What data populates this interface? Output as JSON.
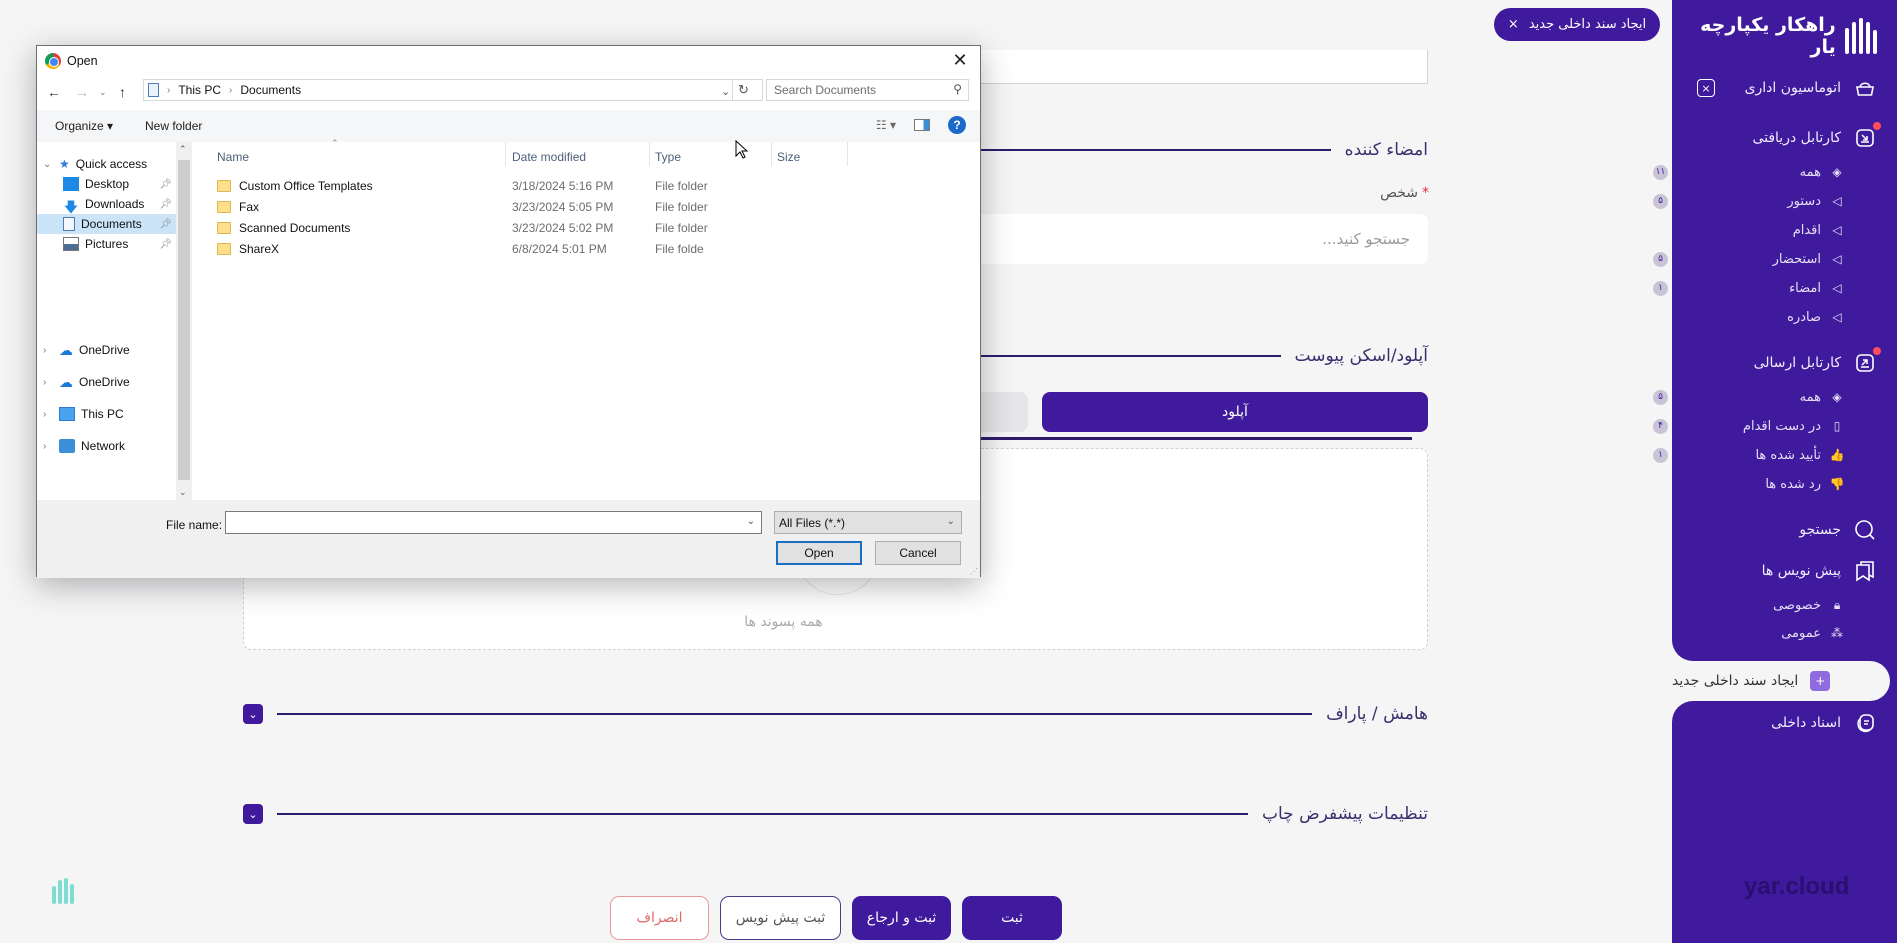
{
  "app": {
    "brand": "راهکار یکپارچه یار",
    "footer_brand": "yar.cloud",
    "accent_color": "#3f1a9c"
  },
  "sidebar": {
    "office_automation": "اتوماسیون اداری",
    "inbox": {
      "label": "کارتابل دریافتی",
      "items": [
        {
          "label": "همه",
          "badge": "۱۱",
          "icon": "layers-icon"
        },
        {
          "label": "دستور",
          "badge": "۵",
          "icon": "triangle-left-icon"
        },
        {
          "label": "اقدام",
          "badge": "",
          "icon": "triangle-left-icon"
        },
        {
          "label": "استحضار",
          "badge": "۵",
          "icon": "triangle-left-icon"
        },
        {
          "label": "امضاء",
          "badge": "۱",
          "icon": "triangle-left-icon"
        },
        {
          "label": "صادره",
          "badge": "",
          "icon": "triangle-left-icon"
        }
      ]
    },
    "outbox": {
      "label": "کارتابل ارسالی",
      "items": [
        {
          "label": "همه",
          "badge": "۵",
          "icon": "layers-icon"
        },
        {
          "label": "در دست اقدام",
          "badge": "۴",
          "icon": "book-icon"
        },
        {
          "label": "تأیید شده ها",
          "badge": "۱",
          "icon": "thumbs-up-icon"
        },
        {
          "label": "رد شده ها",
          "badge": "",
          "icon": "thumbs-down-icon"
        }
      ]
    },
    "search": "جستجو",
    "drafts": {
      "label": "پیش نویس ها",
      "items": [
        {
          "label": "خصوصی",
          "icon": "lock-icon"
        },
        {
          "label": "عمومی",
          "icon": "group-icon"
        }
      ]
    },
    "new_internal_doc": "ایجاد سند داخلی جدید",
    "internal_docs": "اسناد داخلی"
  },
  "top_tab": {
    "label": "ایجاد سند داخلی جدید",
    "close": "×"
  },
  "form": {
    "signer_section": "امضاء کننده",
    "person_label": "شخص",
    "person_required": "*",
    "person_placeholder": "جستجو کنید...",
    "attachment_section": "آپلود/اسکن پیوست",
    "upload_tab": "آپلود",
    "dropzone_text": "همه پسوند ها",
    "margin_section": "هامش / پاراف",
    "print_section": "تنظیمات پیشفرض چاپ",
    "buttons": {
      "submit": "ثبت",
      "submit_return": "ثبت و ارجاع",
      "save_draft": "ثبت پیش نویس",
      "cancel": "انصراف"
    }
  },
  "dialog": {
    "title": "Open",
    "breadcrumb": [
      "This PC",
      "Documents"
    ],
    "search_placeholder": "Search Documents",
    "organize": "Organize",
    "new_folder": "New folder",
    "tree": {
      "quick_access": "Quick access",
      "quick_items": [
        "Desktop",
        "Downloads",
        "Documents",
        "Pictures"
      ],
      "selected": "Documents",
      "roots": [
        "OneDrive",
        "OneDrive",
        "This PC",
        "Network"
      ]
    },
    "columns": [
      "Name",
      "Date modified",
      "Type",
      "Size"
    ],
    "files": [
      {
        "name": "Custom Office Templates",
        "date": "3/18/2024 5:16 PM",
        "type": "File folder",
        "size": ""
      },
      {
        "name": "Fax",
        "date": "3/23/2024 5:05 PM",
        "type": "File folder",
        "size": ""
      },
      {
        "name": "Scanned Documents",
        "date": "3/23/2024 5:02 PM",
        "type": "File folder",
        "size": ""
      },
      {
        "name": "ShareX",
        "date": "6/8/2024 5:01 PM",
        "type": "File folde",
        "size": ""
      }
    ],
    "file_name_label": "File name:",
    "file_name_value": "",
    "file_type": "All Files (*.*)",
    "open": "Open",
    "cancel": "Cancel"
  }
}
